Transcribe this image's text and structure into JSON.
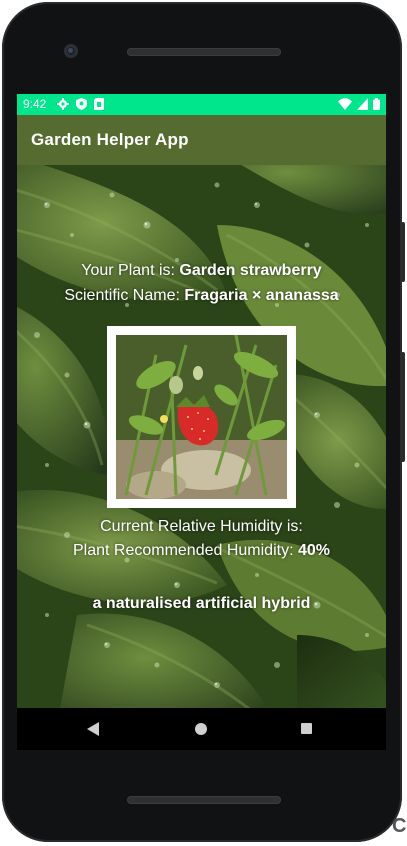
{
  "status_bar": {
    "time": "9:42",
    "left_icons": [
      "gear-icon",
      "shield-icon",
      "sim-card-icon"
    ],
    "right_icons": [
      "wifi-icon",
      "signal-icon",
      "battery-icon"
    ],
    "color": "#00e68c"
  },
  "app_bar": {
    "title": "Garden Helper App",
    "color": "#556b2f"
  },
  "plant": {
    "name_label": "Your Plant is: ",
    "name": "Garden strawberry",
    "scientific_label": "Scientific Name: ",
    "scientific_name": "Fragaria × ananassa",
    "humidity_label": "Current Relative Humidity is:",
    "recommended_label": "Plant Recommended Humidity: ",
    "recommended_value": "40%",
    "description": "a naturalised artificial hybrid"
  },
  "nav_bar": {
    "buttons": [
      "back-icon",
      "home-icon",
      "recent-apps-icon"
    ]
  },
  "edge_text": "C"
}
